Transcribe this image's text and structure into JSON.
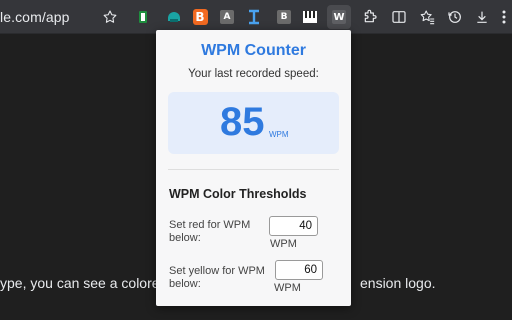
{
  "browser": {
    "url": "le.com/app",
    "toolbar_icons": [
      "star-icon",
      "ext-green-icon",
      "ext-teal-icon",
      "ext-orange-b-icon",
      "ext-a-icon",
      "ext-blue-i-icon",
      "ext-b-icon",
      "ext-piano-icon",
      "ext-w-icon",
      "puzzle-icon",
      "split-view-icon",
      "favorites-icon",
      "history-icon",
      "downloads-icon",
      "more-icon"
    ],
    "ext_a_label": "A",
    "ext_b_label": "B",
    "ext_w_label": "W",
    "ext_orange_label": "B"
  },
  "page": {
    "text_left": "ype, you can see a colored b",
    "text_right": "ension logo."
  },
  "popup": {
    "title": "WPM Counter",
    "subtitle": "Your last recorded speed:",
    "speed_value": "85",
    "speed_unit": "WPM",
    "thresholds_title": "WPM Color Thresholds",
    "red_label": "Set red for WPM below:",
    "red_value": "40",
    "red_unit": "WPM",
    "yellow_label": "Set yellow for WPM below:",
    "yellow_value": "60",
    "yellow_unit": "WPM"
  },
  "colors": {
    "accent": "#2f7adf",
    "card_bg": "#e5edfb",
    "toolbar_bg": "#35363a",
    "page_bg": "#1f1f1f"
  }
}
